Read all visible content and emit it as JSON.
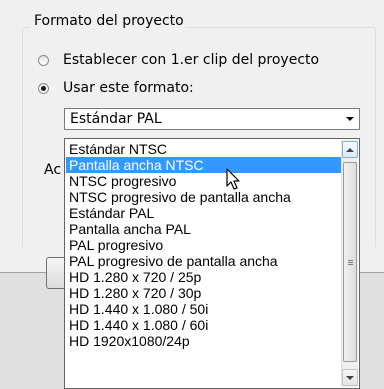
{
  "group": {
    "title": "Formato del proyecto",
    "radio_clip": "Establecer con 1.er clip del proyecto",
    "radio_format": "Usar este formato:"
  },
  "combo": {
    "value": "Estándar PAL"
  },
  "partial_label": "Ac",
  "dropdown": {
    "selected_index": 1,
    "items": [
      "Estándar NTSC",
      "Pantalla ancha NTSC",
      "NTSC progresivo",
      "NTSC progresivo de pantalla ancha",
      "Estándar PAL",
      "Pantalla ancha PAL",
      "PAL progresivo",
      "PAL progresivo de pantalla ancha",
      "HD 1.280 x 720 / 25p",
      "HD 1.280 x 720 / 30p",
      "HD 1.440 x 1.080 / 50i",
      "HD 1.440 x 1.080 / 60i",
      "HD 1920x1080/24p"
    ]
  },
  "colors": {
    "selection": "#3399ff",
    "background": "#f0f0f0"
  }
}
